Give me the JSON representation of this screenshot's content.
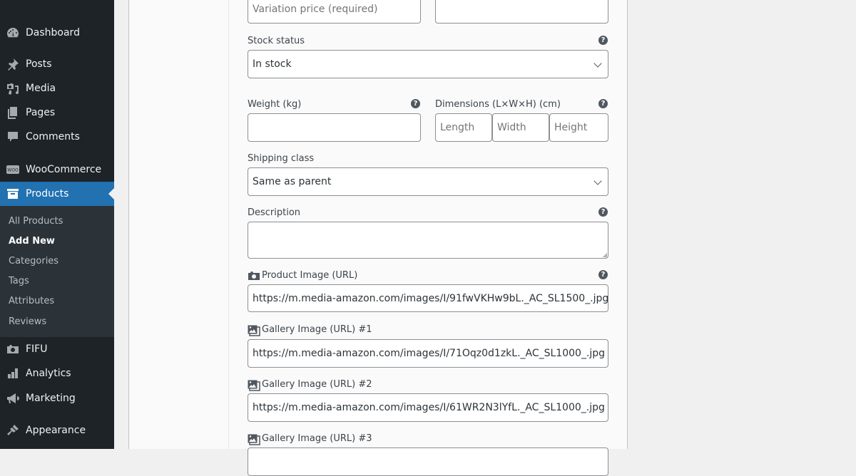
{
  "sidebar": {
    "items": [
      {
        "label": "Dashboard",
        "icon": "dashboard-icon"
      },
      {
        "label": "Posts",
        "icon": "pin-icon"
      },
      {
        "label": "Media",
        "icon": "media-icon"
      },
      {
        "label": "Pages",
        "icon": "pages-icon"
      },
      {
        "label": "Comments",
        "icon": "comment-icon"
      },
      {
        "label": "WooCommerce",
        "icon": "woo-icon"
      },
      {
        "label": "Products",
        "icon": "archive-icon",
        "active": true
      },
      {
        "label": "FIFU",
        "icon": "camera-icon"
      },
      {
        "label": "Analytics",
        "icon": "bar-chart-icon"
      },
      {
        "label": "Marketing",
        "icon": "megaphone-icon"
      },
      {
        "label": "Appearance",
        "icon": "paintbrush-icon"
      }
    ],
    "submenu": [
      {
        "label": "All Products"
      },
      {
        "label": "Add New",
        "current": true
      },
      {
        "label": "Categories"
      },
      {
        "label": "Tags"
      },
      {
        "label": "Attributes"
      },
      {
        "label": "Reviews"
      }
    ],
    "active_color": "#2271b1"
  },
  "form": {
    "price": {
      "placeholder": "Variation price (required)",
      "value": ""
    },
    "sale_price": {
      "value": ""
    },
    "stock_status": {
      "label": "Stock status",
      "value": "In stock"
    },
    "weight": {
      "label": "Weight (kg)",
      "value": ""
    },
    "dimensions": {
      "label": "Dimensions (L×W×H) (cm)",
      "length_placeholder": "Length",
      "width_placeholder": "Width",
      "height_placeholder": "Height"
    },
    "shipping_class": {
      "label": "Shipping class",
      "value": "Same as parent"
    },
    "description": {
      "label": "Description",
      "value": ""
    },
    "product_image": {
      "label": "Product Image (URL)",
      "value": "https://m.media-amazon.com/images/I/91fwVKHw9bL._AC_SL1500_.jpg"
    },
    "gallery": [
      {
        "label": "Gallery Image (URL) #1",
        "value": "https://m.media-amazon.com/images/I/71Oqz0d1zkL._AC_SL1000_.jpg"
      },
      {
        "label": "Gallery Image (URL) #2",
        "value": "https://m.media-amazon.com/images/I/61WR2N3lYfL._AC_SL1000_.jpg"
      },
      {
        "label": "Gallery Image (URL) #3",
        "value": ""
      }
    ],
    "help_glyph": "?"
  }
}
